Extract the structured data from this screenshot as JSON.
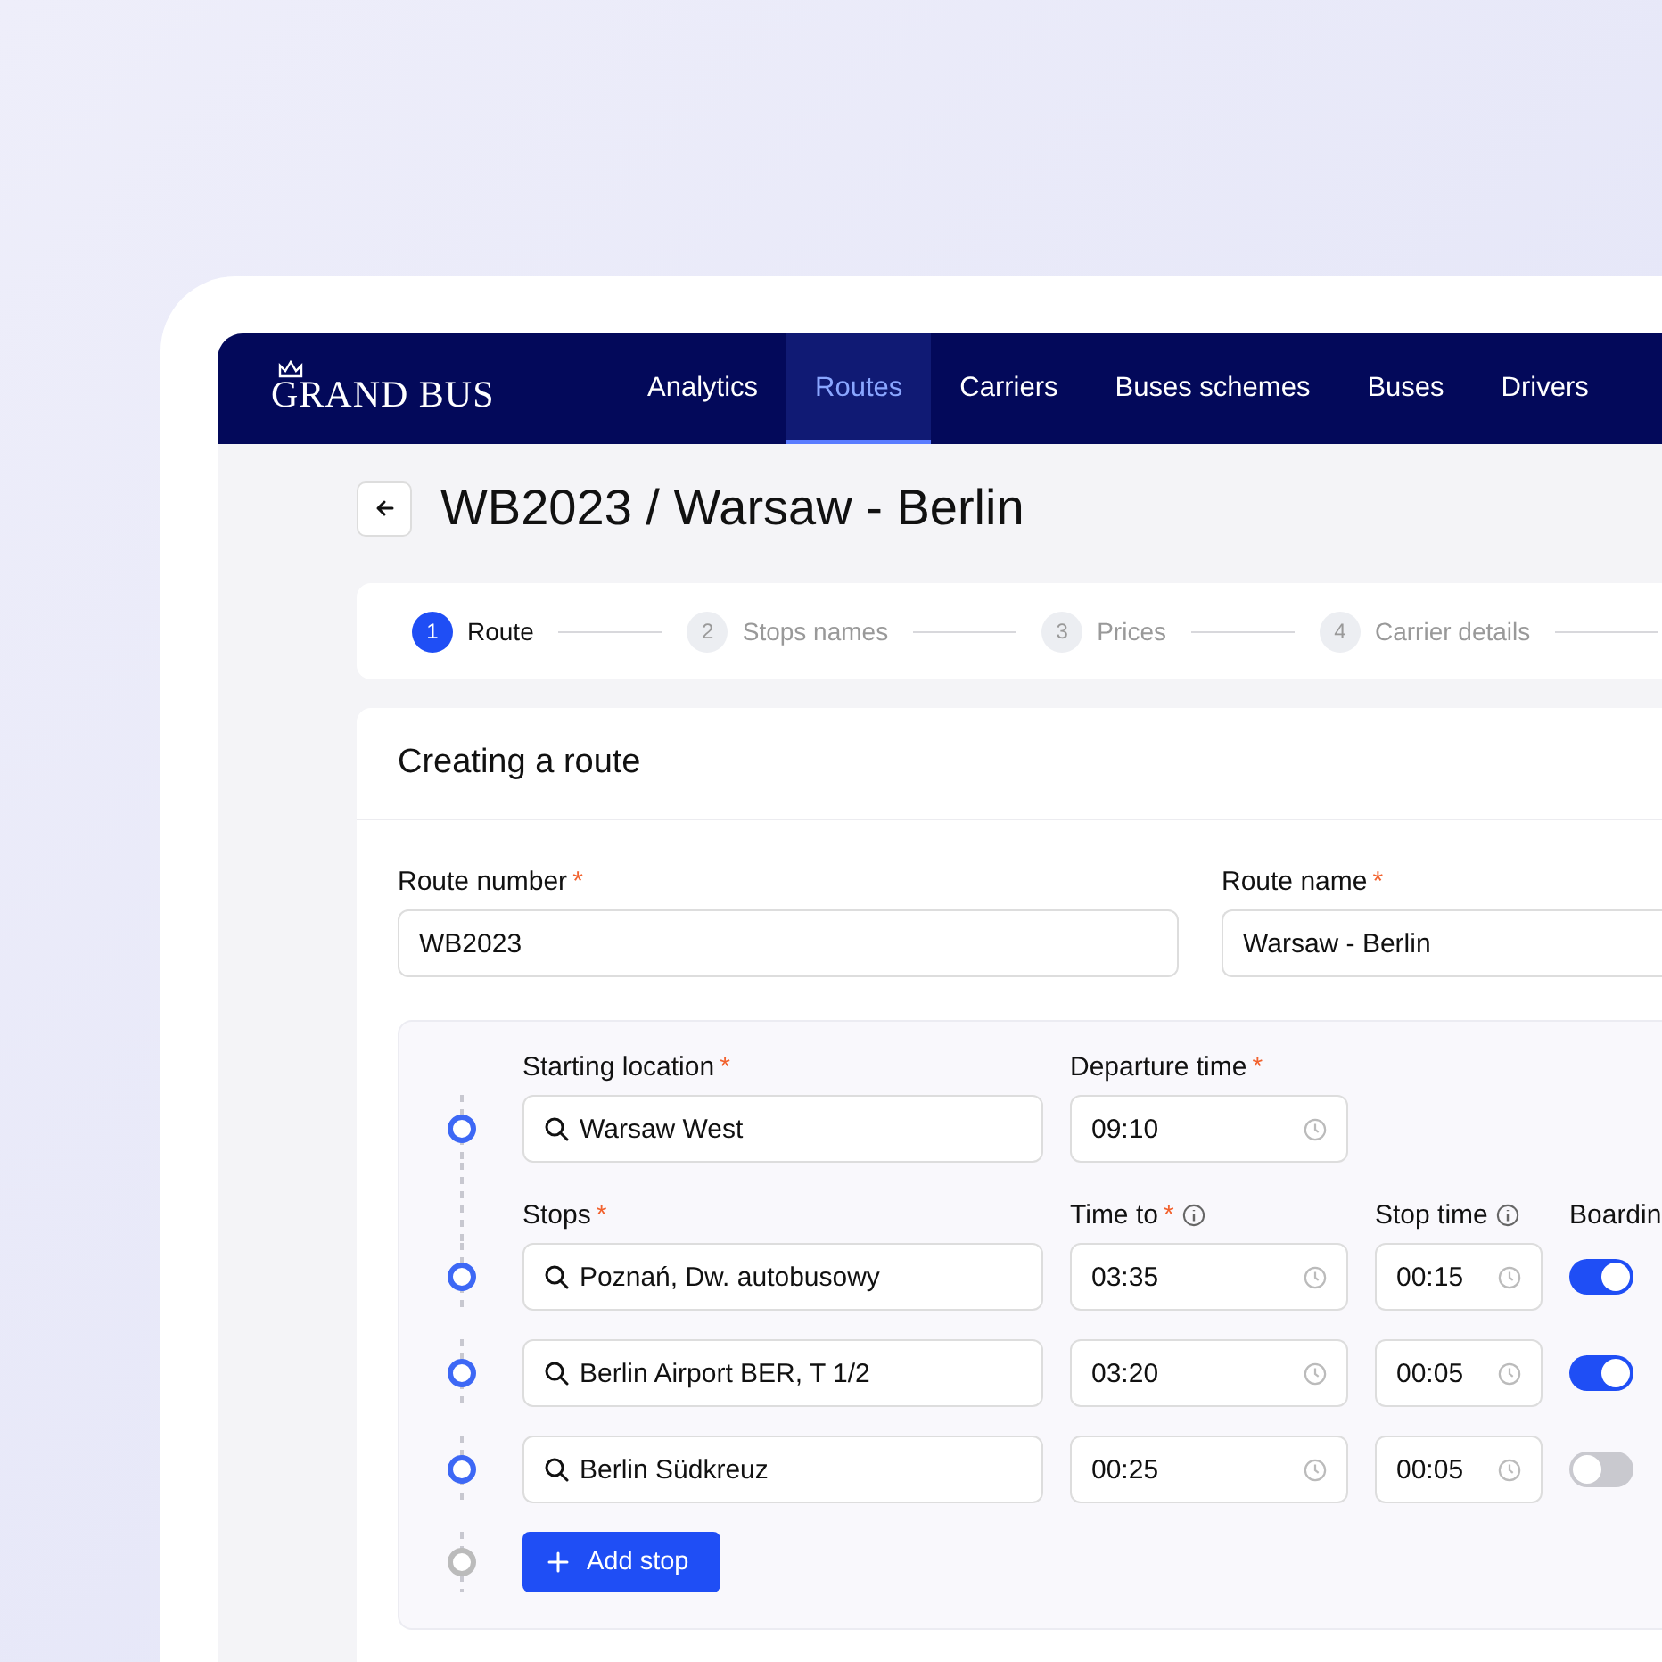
{
  "logo": "GRAND BUS",
  "nav": [
    {
      "label": "Analytics",
      "selected": false
    },
    {
      "label": "Routes",
      "selected": true
    },
    {
      "label": "Carriers",
      "selected": false
    },
    {
      "label": "Buses schemes",
      "selected": false
    },
    {
      "label": "Buses",
      "selected": false
    },
    {
      "label": "Drivers",
      "selected": false
    }
  ],
  "page_title": "WB2023 / Warsaw - Berlin",
  "steps": [
    {
      "number": "1",
      "label": "Route",
      "selected": true
    },
    {
      "number": "2",
      "label": "Stops names",
      "selected": false
    },
    {
      "number": "3",
      "label": "Prices",
      "selected": false
    },
    {
      "number": "4",
      "label": "Carrier details",
      "selected": false
    }
  ],
  "card_title": "Creating a route",
  "route_fields": [
    {
      "label": "Route number",
      "required_mark": "*",
      "value": "WB2023"
    },
    {
      "label": "Route name",
      "required_mark": "*",
      "value": "Warsaw - Berlin"
    }
  ],
  "start": {
    "location": {
      "label": "Starting location",
      "required_mark": "*",
      "value": "Warsaw West"
    },
    "departure": {
      "label": "Departure time",
      "required_mark": "*",
      "value": "09:10"
    }
  },
  "stop_columns": [
    {
      "label": "Stops",
      "required_mark": "*",
      "info": false
    },
    {
      "label": "Time to",
      "required_mark": "*",
      "info": true
    },
    {
      "label": "Stop time",
      "info": true
    },
    {
      "label": "Boardin",
      "info": false
    }
  ],
  "stops": [
    {
      "location": "Poznań, Dw. autobusowy",
      "time_to": "03:35",
      "stop_time": "00:15",
      "boarding": true
    },
    {
      "location": "Berlin Airport BER, T 1/2",
      "time_to": "03:20",
      "stop_time": "00:05",
      "boarding": true
    },
    {
      "location": "Berlin Südkreuz",
      "time_to": "00:25",
      "stop_time": "00:05",
      "boarding": false
    }
  ],
  "add_stop": "Add stop"
}
